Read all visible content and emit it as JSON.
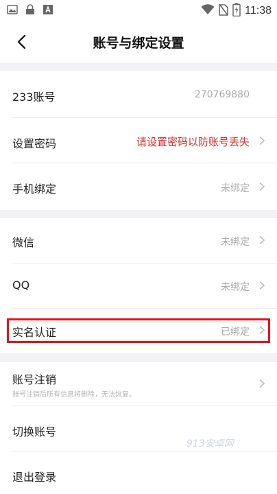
{
  "status_bar": {
    "time": "11:38",
    "left_icons": [
      "gallery-icon",
      "lock-icon",
      "font-icon"
    ],
    "right_icons": [
      "wifi-icon",
      "no-sim-icon",
      "battery-charging-icon"
    ]
  },
  "header": {
    "title": "账号与绑定设置",
    "back_icon": "chevron-left-icon"
  },
  "group1": [
    {
      "label": "233账号",
      "value": "270769880",
      "has_chevron": false
    },
    {
      "label": "设置密码",
      "value": "请设置密码以防账号丢失",
      "has_chevron": true,
      "value_color": "#d4322c"
    },
    {
      "label": "手机绑定",
      "value": "未绑定",
      "has_chevron": true
    }
  ],
  "group2": [
    {
      "label": "微信",
      "value": "未绑定",
      "has_chevron": true
    },
    {
      "label": "QQ",
      "value": "未绑定",
      "has_chevron": true
    },
    {
      "label": "实名认证",
      "value": "已绑定",
      "has_chevron": true,
      "highlighted": true
    }
  ],
  "group3": [
    {
      "label": "账号注销",
      "sub": "账号注销后所有信息将删除，无法恢复。",
      "has_chevron": true
    },
    {
      "label": "切换账号"
    },
    {
      "label": "退出登录"
    }
  ],
  "watermark": "913安卓网",
  "colors": {
    "background": "#ffffff",
    "section_gap": "#f2f2f4",
    "warning": "#d4322c",
    "highlight_border": "#e0161e",
    "muted": "#aaaaaa"
  }
}
